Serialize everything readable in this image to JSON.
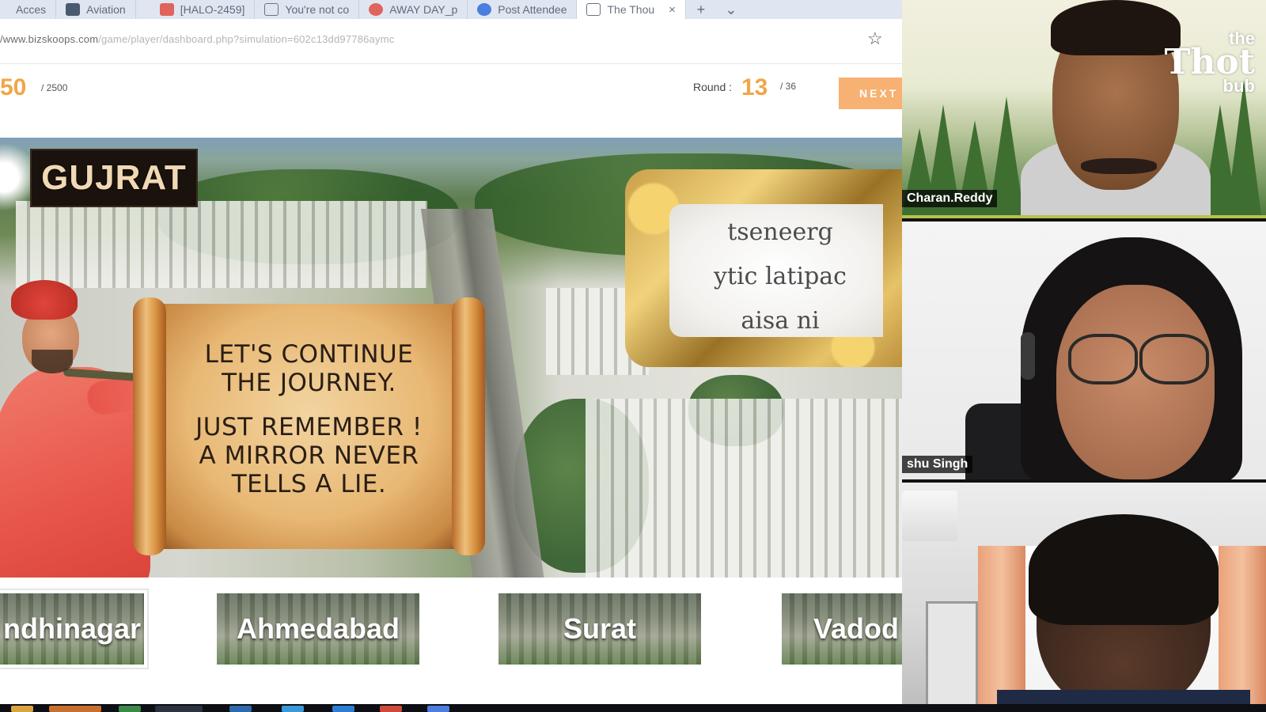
{
  "browser": {
    "tabs": [
      {
        "label": "Acces",
        "icon": "page-icon",
        "color": "#5f6b7a"
      },
      {
        "label": "Aviation",
        "icon": "app-icon",
        "color": "#4a5a70"
      },
      {
        "label": "[HALO-2459]",
        "icon": "jira-icon",
        "color": "#e0645c"
      },
      {
        "label": "You're not co",
        "icon": "page-icon",
        "color": "#6a7380"
      },
      {
        "label": "AWAY DAY_p",
        "icon": "drive-icon",
        "color": "#e0645c"
      },
      {
        "label": "Post Attendee",
        "icon": "zoom-icon",
        "color": "#4c7de0"
      },
      {
        "label": "The Thou",
        "icon": "page-icon",
        "color": "#6a7380",
        "active": true
      }
    ],
    "new_tab_glyph": "+",
    "tab_list_glyph": "⌄",
    "close_glyph": "×",
    "url_host": "/www.bizskoops.com",
    "url_path": "/game/player/dashboard.php?simulation=602c13dd97786aymc",
    "star_glyph": "☆"
  },
  "game": {
    "score": "50",
    "score_max": "/ 2500",
    "round_label": "Round :",
    "round_value": "13",
    "round_total": "/ 36",
    "next_label": "NEXT"
  },
  "scene": {
    "region_title": "GUJRAT",
    "scroll_lines": [
      "LET'S CONTINUE",
      "THE JOURNEY.",
      "",
      "JUST REMEMBER !",
      "A MIRROR NEVER",
      "TELLS A LIE."
    ],
    "mirror_lines": [
      "tseneerg",
      "ytic latipac",
      "aisa ni"
    ]
  },
  "cities": [
    {
      "label": "ndhinagar",
      "selected": true
    },
    {
      "label": "Ahmedabad"
    },
    {
      "label": "Surat"
    },
    {
      "label": "Vadod"
    }
  ],
  "participants": [
    {
      "name": "Charan.Reddy"
    },
    {
      "name": "shu Singh"
    },
    {
      "name": ""
    }
  ],
  "brand": {
    "small": "the",
    "big": "Thot",
    "sub": "bub"
  },
  "colors": {
    "accent": "#f0a64a",
    "next_button": "#f7b172",
    "speaker_border": "#b6c34c"
  }
}
